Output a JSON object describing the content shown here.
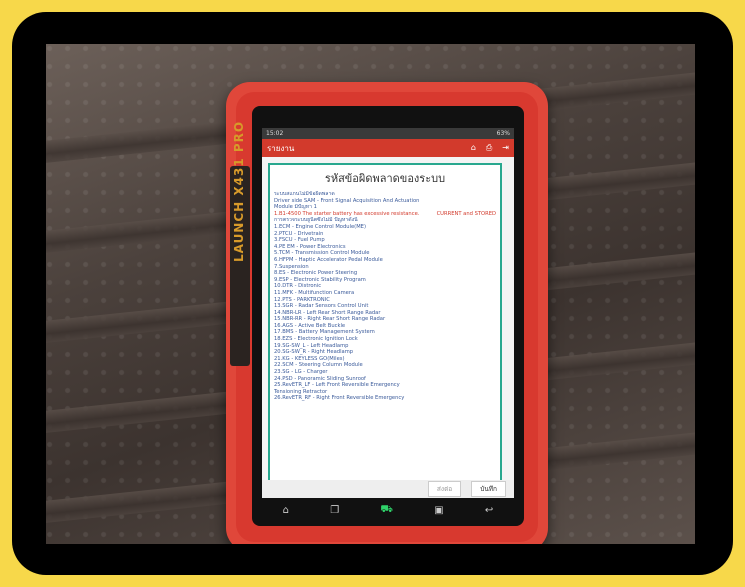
{
  "device": {
    "brand": "LAUNCH X431 PRO"
  },
  "status_bar": {
    "time": "15:02",
    "battery": "63%"
  },
  "app_bar": {
    "title": "รายงาน",
    "icons": [
      "home-icon",
      "print-icon",
      "exit-icon"
    ]
  },
  "report": {
    "title": "รหัสข้อผิดพลาดของระบบ",
    "lines": [
      "ระบบสแกนไม่มีข้อผิดพลาด",
      "Driver side SAM - Front Signal Acquisition And Actuation",
      "Module มีปัญหา 1"
    ],
    "dtc_code": "1.B1-4500 The starter battery has excessive resistance.",
    "dtc_status": "CURRENT and STORED",
    "ok_header": "การตรวจระบบยูนิตซึ่งไม่มี ปัญหาดังนี้",
    "modules": [
      "1.ECM - Engine Control Module(ME)",
      "2.PTCU - Drivetrain",
      "3.FSCU - Fuel Pump",
      "4.PE EM - Power Electronics",
      "5.TCM - Transmission Control Module",
      "6.HFPM - Haptic Accelerator Pedal Module",
      "7.Suspension",
      "8.ES - Electronic Power Steering",
      "9.ESP - Electronic Stability Program",
      "10.DTR - Distronic",
      "11.MFK - Multifunction Camera",
      "12.PTS - PARKTRONIC",
      "13.SGR - Radar Sensors Control Unit",
      "14.NBR-LR - Left Rear Short Range Radar",
      "15.NBR-RR - Right Rear Short Range Radar",
      "16.AGS - Active Belt Buckle",
      "17.BMS - Battery Management System",
      "18.EZS - Electronic Ignition Lock",
      "19.SG-SW_L - Left Headlamp",
      "20.SG-SW_R - Right Headlamp",
      "21.KG - KEYLESS GO(Miles)",
      "22.SCM - Steering Column Module",
      "23.SG - LG - Charger",
      "24.PSD - Panoramic Sliding Sunroof",
      "25.RevETR_LF - Left Front Reversible Emergency",
      "Tensioning Retractor",
      "26.RevETR_RF - Right Front Reversible Emergency"
    ]
  },
  "bottom_buttons": {
    "send": "ส่งต่อ",
    "save": "บันทึก"
  },
  "nav_icons": [
    "home-icon",
    "recents-icon",
    "vci-icon",
    "gallery-icon",
    "back-icon"
  ]
}
